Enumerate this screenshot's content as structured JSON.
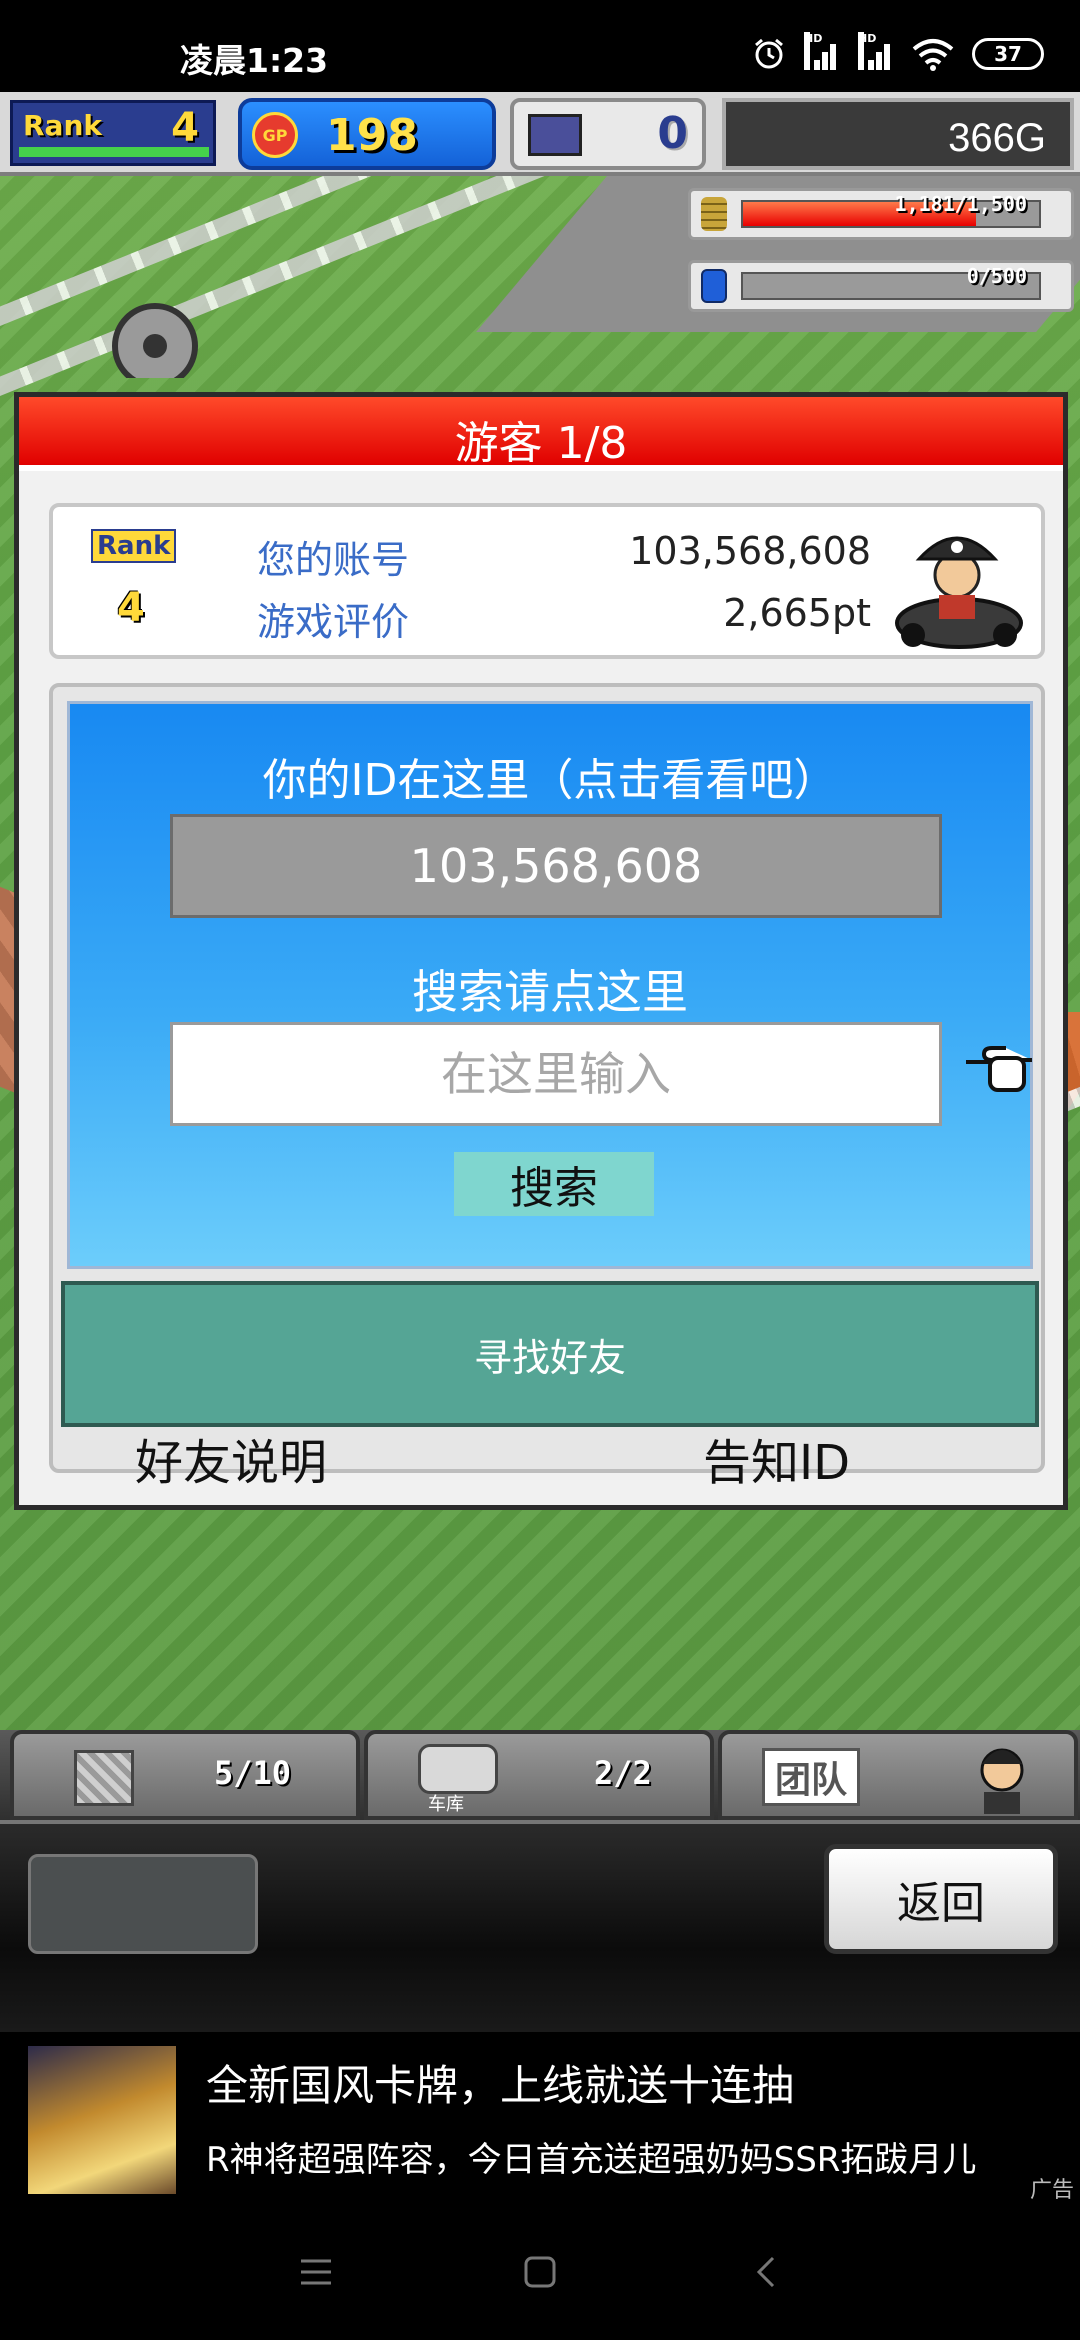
{
  "status_bar": {
    "time": "凌晨1:23",
    "battery": "37",
    "signal_tag": "HD"
  },
  "top_bar": {
    "rank_label": "Rank",
    "rank_value": "4",
    "rank_progress": 1.0,
    "gp_label": "GP",
    "gp_value": "198",
    "research_value": "0",
    "money": "366G",
    "coin_meter": {
      "text": "1,181/1,500",
      "fraction": 0.787
    },
    "fuel_meter": {
      "text": "0/500",
      "fraction": 0.0
    }
  },
  "modal": {
    "title": "游客 1/8",
    "info": {
      "rank_label": "Rank",
      "rank_value": "4",
      "account_label": "您的账号",
      "account_value": "103,568,608",
      "rating_label": "游戏评价",
      "rating_value": "2,665pt"
    },
    "search": {
      "id_heading": "你的ID在这里（点击看看吧）",
      "id_value": "103,568,608",
      "search_heading": "搜索请点这里",
      "input_placeholder": "在这里输入",
      "search_button": "搜索"
    },
    "find_friends_button": "寻找好友",
    "friend_info_link": "好友说明",
    "share_id_link": "告知ID"
  },
  "bottom_tabs": {
    "storage_value": "5/10",
    "garage_label": "车库",
    "garage_value": "2/2",
    "team_label": "团队"
  },
  "control_panel": {
    "back_button": "返回"
  },
  "ad": {
    "title": "全新国风卡牌，上线就送十连抽",
    "description": "R神将超强阵容，今日首充送超强奶妈SSR拓跋月儿",
    "tag": "广告"
  },
  "colors": {
    "header_red": "#e00000",
    "panel_blue": "#1889f2",
    "find_friends_teal": "#55a595",
    "search_button": "#7fd6cf"
  }
}
